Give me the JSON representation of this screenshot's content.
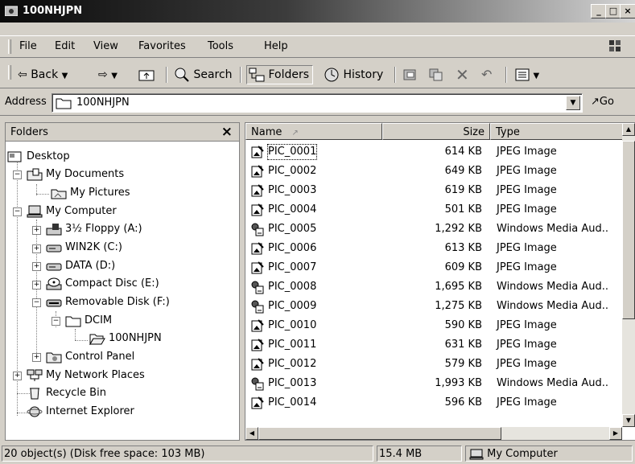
{
  "window": {
    "title": "100NHJPN",
    "icon": "folder-window-icon",
    "controls": [
      "minimize-icon",
      "maximize-icon",
      "close-icon"
    ]
  },
  "menu": {
    "items": [
      "File",
      "Edit",
      "View",
      "Favorites",
      "Tools",
      "Help"
    ]
  },
  "toolbar": {
    "back_label": "Back",
    "search_label": "Search",
    "folders_label": "Folders",
    "history_label": "History"
  },
  "address": {
    "label": "Address",
    "value": "100NHJPN",
    "go_label": "Go"
  },
  "folders_pane": {
    "title": "Folders",
    "close": "×",
    "items": [
      {
        "label": "Desktop",
        "icon": "desktop-icon"
      },
      {
        "label": "My Documents",
        "icon": "my-documents-icon"
      },
      {
        "label": "My Pictures",
        "icon": "my-pictures-icon"
      },
      {
        "label": "My Computer",
        "icon": "my-computer-icon"
      },
      {
        "label": "3½ Floppy (A:)",
        "icon": "floppy-drive-icon"
      },
      {
        "label": "WIN2K (C:)",
        "icon": "hard-drive-icon"
      },
      {
        "label": "DATA (D:)",
        "icon": "hard-drive-icon"
      },
      {
        "label": "Compact Disc (E:)",
        "icon": "cd-drive-icon"
      },
      {
        "label": "Removable Disk (F:)",
        "icon": "removable-disk-icon"
      },
      {
        "label": "DCIM",
        "icon": "folder-icon"
      },
      {
        "label": "100NHJPN",
        "icon": "open-folder-icon"
      },
      {
        "label": "Control Panel",
        "icon": "control-panel-icon"
      },
      {
        "label": "My Network Places",
        "icon": "network-places-icon"
      },
      {
        "label": "Recycle Bin",
        "icon": "recycle-bin-icon"
      },
      {
        "label": "Internet Explorer",
        "icon": "internet-explorer-icon"
      }
    ]
  },
  "file_list": {
    "columns": {
      "name": "Name",
      "size": "Size",
      "type": "Type"
    },
    "rows": [
      {
        "name": "PIC_0001",
        "size": "614 KB",
        "type": "JPEG Image",
        "icon": "jpeg-file-icon"
      },
      {
        "name": "PIC_0002",
        "size": "649 KB",
        "type": "JPEG Image",
        "icon": "jpeg-file-icon"
      },
      {
        "name": "PIC_0003",
        "size": "619 KB",
        "type": "JPEG Image",
        "icon": "jpeg-file-icon"
      },
      {
        "name": "PIC_0004",
        "size": "501 KB",
        "type": "JPEG Image",
        "icon": "jpeg-file-icon"
      },
      {
        "name": "PIC_0005",
        "size": "1,292 KB",
        "type": "Windows Media Aud..",
        "icon": "audio-file-icon"
      },
      {
        "name": "PIC_0006",
        "size": "613 KB",
        "type": "JPEG Image",
        "icon": "jpeg-file-icon"
      },
      {
        "name": "PIC_0007",
        "size": "609 KB",
        "type": "JPEG Image",
        "icon": "jpeg-file-icon"
      },
      {
        "name": "PIC_0008",
        "size": "1,695 KB",
        "type": "Windows Media Aud..",
        "icon": "audio-file-icon"
      },
      {
        "name": "PIC_0009",
        "size": "1,275 KB",
        "type": "Windows Media Aud..",
        "icon": "audio-file-icon"
      },
      {
        "name": "PIC_0010",
        "size": "590 KB",
        "type": "JPEG Image",
        "icon": "jpeg-file-icon"
      },
      {
        "name": "PIC_0011",
        "size": "631 KB",
        "type": "JPEG Image",
        "icon": "jpeg-file-icon"
      },
      {
        "name": "PIC_0012",
        "size": "579 KB",
        "type": "JPEG Image",
        "icon": "jpeg-file-icon"
      },
      {
        "name": "PIC_0013",
        "size": "1,993 KB",
        "type": "Windows Media Aud..",
        "icon": "audio-file-icon"
      },
      {
        "name": "PIC_0014",
        "size": "596 KB",
        "type": "JPEG Image",
        "icon": "jpeg-file-icon"
      }
    ]
  },
  "status": {
    "objects": "20 object(s) (Disk free space: 103 MB)",
    "size": "15.4 MB",
    "zone": "My Computer"
  }
}
